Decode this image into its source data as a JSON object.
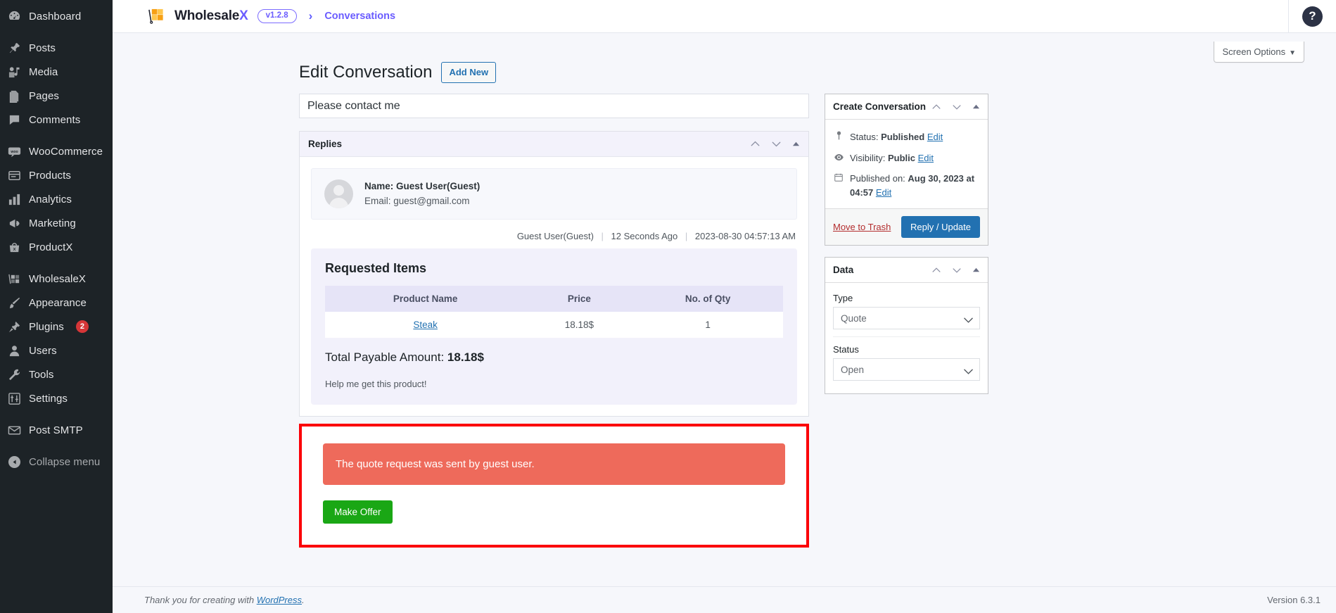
{
  "sidebar": {
    "items": [
      {
        "label": "Dashboard",
        "icon": "dashboard-icon",
        "gap_after": true
      },
      {
        "label": "Posts",
        "icon": "posts-pin-icon",
        "gap_after": false
      },
      {
        "label": "Media",
        "icon": "media-icon",
        "gap_after": false
      },
      {
        "label": "Pages",
        "icon": "pages-icon",
        "gap_after": false
      },
      {
        "label": "Comments",
        "icon": "comments-icon",
        "gap_after": true
      },
      {
        "label": "WooCommerce",
        "icon": "woocommerce-icon",
        "gap_after": false
      },
      {
        "label": "Products",
        "icon": "products-icon",
        "gap_after": false
      },
      {
        "label": "Analytics",
        "icon": "analytics-bars-icon",
        "gap_after": false
      },
      {
        "label": "Marketing",
        "icon": "marketing-megaphone-icon",
        "gap_after": false
      },
      {
        "label": "ProductX",
        "icon": "productx-icon",
        "gap_after": true
      },
      {
        "label": "WholesaleX",
        "icon": "wholesalex-icon",
        "gap_after": false
      },
      {
        "label": "Appearance",
        "icon": "appearance-brush-icon",
        "gap_after": false
      },
      {
        "label": "Plugins",
        "icon": "plugins-icon",
        "badge": "2",
        "gap_after": false
      },
      {
        "label": "Users",
        "icon": "users-icon",
        "gap_after": false
      },
      {
        "label": "Tools",
        "icon": "tools-wrench-icon",
        "gap_after": false
      },
      {
        "label": "Settings",
        "icon": "settings-sliders-icon",
        "gap_after": true
      },
      {
        "label": "Post SMTP",
        "icon": "mail-envelope-icon",
        "gap_after": false
      }
    ],
    "collapse_label": "Collapse menu"
  },
  "topbar": {
    "brand_name": "Wholesale",
    "brand_accent": "X",
    "version_badge": "v1.2.8",
    "breadcrumb": "Conversations",
    "help_glyph": "?"
  },
  "screen_options": {
    "label": "Screen Options",
    "caret": "▼"
  },
  "page": {
    "title": "Edit Conversation",
    "add_new_label": "Add New",
    "conversation_title_value": "Please contact me",
    "conversation_title_placeholder": "Add title"
  },
  "replies_box": {
    "title": "Replies",
    "user": {
      "name_line": "Name: Guest User(Guest)",
      "email_line": "Email: guest@gmail.com"
    },
    "meta": {
      "author": "Guest User(Guest)",
      "relative_time": "12 Seconds Ago",
      "timestamp": "2023-08-30 04:57:13 AM",
      "separator": "|"
    },
    "requested_items": {
      "heading": "Requested Items",
      "columns": [
        "Product Name",
        "Price",
        "No. of Qty"
      ],
      "rows": [
        {
          "product": "Steak",
          "price": "18.18$",
          "qty": "1"
        }
      ],
      "total_label": "Total Payable Amount:",
      "total_value": "18.18$",
      "note": "Help me get this product!"
    }
  },
  "offer_block": {
    "alert_text": "The quote request was sent by guest user.",
    "alert_color": "#ee6a5b",
    "highlight_border_color": "#fb0007",
    "button_label": "Make Offer",
    "button_color": "#1aa715"
  },
  "create_conversation_box": {
    "title": "Create Conversation",
    "status_label": "Status:",
    "status_value": "Published",
    "status_edit": "Edit",
    "visibility_label": "Visibility:",
    "visibility_value": "Public",
    "visibility_edit": "Edit",
    "published_label": "Published on:",
    "published_value": "Aug 30, 2023 at 04:57",
    "published_edit": "Edit",
    "trash_label": "Move to Trash",
    "submit_label": "Reply / Update"
  },
  "data_box": {
    "title": "Data",
    "type_label": "Type",
    "type_value": "Quote",
    "status_label": "Status",
    "status_value": "Open"
  },
  "footer": {
    "thanks_prefix": "Thank you for creating with ",
    "thanks_link": "WordPress",
    "thanks_suffix": ".",
    "version": "Version 6.3.1"
  }
}
